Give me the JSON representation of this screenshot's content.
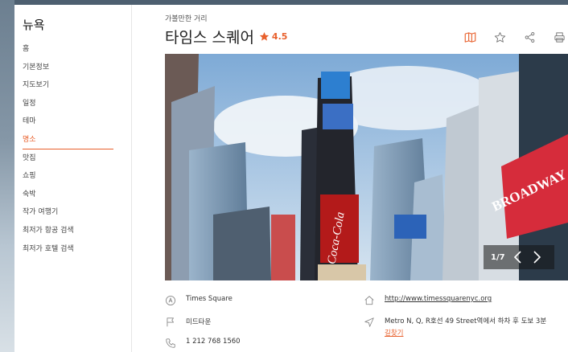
{
  "sidebar": {
    "city": "뉴욕",
    "items": [
      {
        "label": "홈"
      },
      {
        "label": "기본정보"
      },
      {
        "label": "지도보기"
      },
      {
        "label": "일정"
      },
      {
        "label": "테마"
      },
      {
        "label": "명소",
        "active": true
      },
      {
        "label": "맛집"
      },
      {
        "label": "쇼핑"
      },
      {
        "label": "숙박"
      },
      {
        "label": "작가 여행기"
      },
      {
        "label": "최저가 항공 검색"
      },
      {
        "label": "최저가 호텔 검색"
      }
    ]
  },
  "header": {
    "eyebrow": "가볼만한 거리",
    "title": "타임스 스퀘어",
    "rating": "4.5",
    "tools": [
      "map-icon",
      "star-outline-icon",
      "share-icon",
      "print-icon"
    ]
  },
  "gallery": {
    "counter": "1/7",
    "image_signs": {
      "coca_cola": "Coca-Cola",
      "broadway": "BROADWAY"
    }
  },
  "info": {
    "name_en": "Times Square",
    "area": "미드타운",
    "phone": "1 212 768 1560",
    "website": "http://www.timessquarenyc.org",
    "directions": "Metro N, Q, R호선 49 Street역에서 하차 후 도보 3분",
    "directions_link": "길찾기"
  },
  "colors": {
    "accent": "#e8602c",
    "title": "#222222",
    "text": "#333333"
  }
}
